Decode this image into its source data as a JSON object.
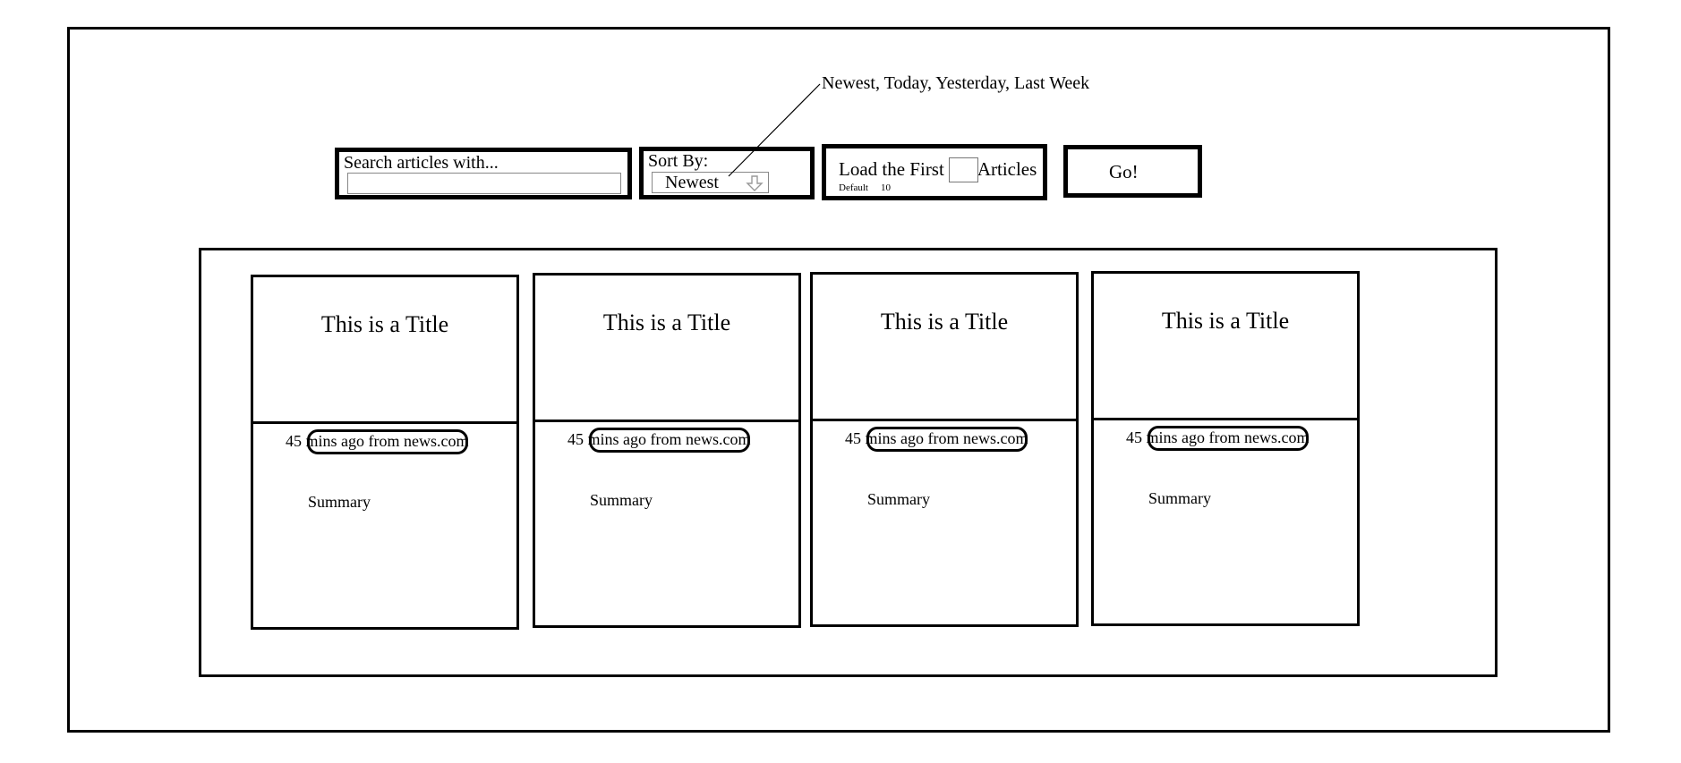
{
  "toolbar": {
    "search_label": "Search articles with...",
    "search_value": "",
    "sort_label": "Sort By:",
    "sort_value": "Newest",
    "load_prefix": "Load the First",
    "load_suffix": "Articles",
    "load_default_label": "Default",
    "load_default_value": "10",
    "go_label": "Go!"
  },
  "annotation": {
    "sort_options": "Newest, Today, Yesterday, Last Week"
  },
  "icons": {
    "sort_arrow": "arrow-down-icon"
  },
  "articles": [
    {
      "title": "This is a Title",
      "meta": "45 mins ago from news.com",
      "summary": "Summary"
    },
    {
      "title": "This is a Title",
      "meta": "45 mins ago from news.com",
      "summary": "Summary"
    },
    {
      "title": "This is a Title",
      "meta": "45 mins ago from news.com",
      "summary": "Summary"
    },
    {
      "title": "This is a Title",
      "meta": "45 mins ago from news.com",
      "summary": "Summary"
    }
  ]
}
